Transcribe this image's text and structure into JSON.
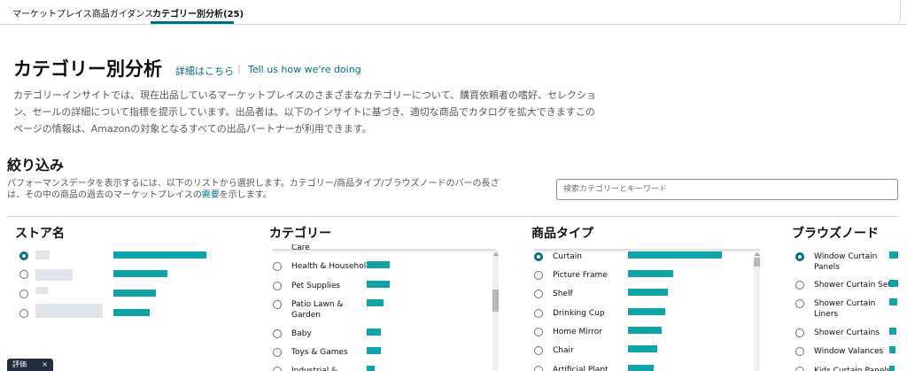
{
  "tabs": [
    "マーケットプレイス商品ガイダンス",
    "カテゴリー別分析(25)"
  ],
  "header": {
    "title": "カテゴリー別分析",
    "link_details": "詳細はこちら",
    "link_sep": "|",
    "link_feedback": "Tell us how we're doing"
  },
  "description": "カテゴリーインサイトでは、現在出品しているマーケットプレイスのさまざまなカテゴリーについて、購買依頼者の嗜好、セレクション、セールの詳細について指標を提示しています。出品者は、以下のインサイトに基づき、適切な商品でカタログを拡大できますこのページの情報は、Amazonの対象となるすべての出品パートナーが利用できます。",
  "filter": {
    "title": "絞り込み",
    "desc_before": "パフォーマンスデータを表示するには、以下のリストから選択します。カテゴリー/商品タイプ/ブラウズノードのバーの長さは、その中の商品の過去のマーケットプレイスの",
    "desc_link": "需要",
    "desc_after": "を示します。",
    "search_placeholder": "検索カテゴリーとキーワード"
  },
  "columns": {
    "store": {
      "title": "ストア名",
      "items": [
        {
          "selected": true,
          "bar": 1.0
        },
        {
          "selected": false,
          "bar": 0.58
        },
        {
          "selected": false,
          "bar": 0.46
        },
        {
          "selected": false,
          "bar": 0.39
        }
      ]
    },
    "category": {
      "title": "カテゴリー",
      "items": [
        {
          "label": "Care",
          "bar": 0,
          "cut": true
        },
        {
          "label": "Health & Household",
          "bar": 1.0
        },
        {
          "label": "Pet Supplies",
          "bar": 1.0
        },
        {
          "label": "Patio Lawn & Garden",
          "bar": 0.72
        },
        {
          "label": "Baby",
          "bar": 0.62
        },
        {
          "label": "Toys & Games",
          "bar": 0.6
        },
        {
          "label": "Industrial &",
          "bar": 0.35,
          "cut": true
        }
      ]
    },
    "product_type": {
      "title": "商品タイプ",
      "items": [
        {
          "label": "Curtain",
          "selected": true,
          "bar": 1.0
        },
        {
          "label": "Picture Frame",
          "bar": 0.48
        },
        {
          "label": "Shelf",
          "bar": 0.42
        },
        {
          "label": "Drinking Cup",
          "bar": 0.4
        },
        {
          "label": "Home Mirror",
          "bar": 0.36
        },
        {
          "label": "Chair",
          "bar": 0.31
        },
        {
          "label": "Artificial Plant",
          "bar": 0.27,
          "cut": true
        }
      ]
    },
    "browse_node": {
      "title": "ブラウズノード",
      "items": [
        {
          "label": "Window Curtain Panels",
          "selected": true,
          "bar": 1.0
        },
        {
          "label": "Shower Curtain Sets",
          "bar": 1.0
        },
        {
          "label": "Shower Curtain Liners",
          "bar": 0.9
        },
        {
          "label": "Shower Curtains",
          "bar": 0.75
        },
        {
          "label": "Window Valances",
          "bar": 0.7
        },
        {
          "label": "Kids Curtain Panels",
          "bar": 0.6,
          "cut": true
        }
      ]
    }
  },
  "feedback": {
    "label": "評価",
    "close": "×"
  },
  "colors": {
    "accent": "#007185",
    "bar": "#10a3a8",
    "text": "#0f1111",
    "muted": "#565959"
  }
}
